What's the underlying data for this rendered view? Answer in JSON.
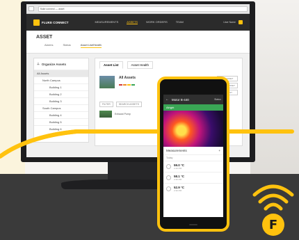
{
  "browser": {
    "url": "fluke connect — asset"
  },
  "app": {
    "brand": "FLUKE CONNECT",
    "nav": [
      "MEASUREMENTS",
      "ASSETS",
      "WORK ORDERS",
      "TEAM"
    ],
    "user": "User Name"
  },
  "page": {
    "title": "ASSET",
    "tabs": [
      "Alarms",
      "Status",
      "Asset List/Health"
    ]
  },
  "left_panel": {
    "heading": "Organize Assets",
    "items": [
      "All Assets",
      "North Campus",
      "Building 1",
      "Building 2",
      "Building 3",
      "South Campus",
      "Building 4",
      "Building 5",
      "Building 6"
    ]
  },
  "main_panel": {
    "tabs": [
      "Asset List",
      "Asset Health"
    ],
    "asset_title": "All Assets",
    "buttons": [
      "ADD ASSET",
      "IMPORT ASSET",
      "EDIT LIST"
    ],
    "filters": [
      "FILTER",
      "SEARCH ASSETS"
    ],
    "row_label": "Exhaust Pump"
  },
  "phone": {
    "header_title": "Motor B-440",
    "header_right": "Status",
    "status_bar": "Alright",
    "section": "Measurements",
    "sub": "Today",
    "measurements": [
      {
        "value": "59.0 °C",
        "date": "2:40 PM"
      },
      {
        "value": "58.1 °C",
        "date": "2:35 PM"
      },
      {
        "value": "52.9 °C",
        "date": "2:30 PM"
      }
    ]
  },
  "badge": {
    "letter": "F",
    "icon": "wifi-icon"
  },
  "colors": {
    "accent": "#ffc20e",
    "dark": "#2b2b2b",
    "green": "#3aa655"
  }
}
